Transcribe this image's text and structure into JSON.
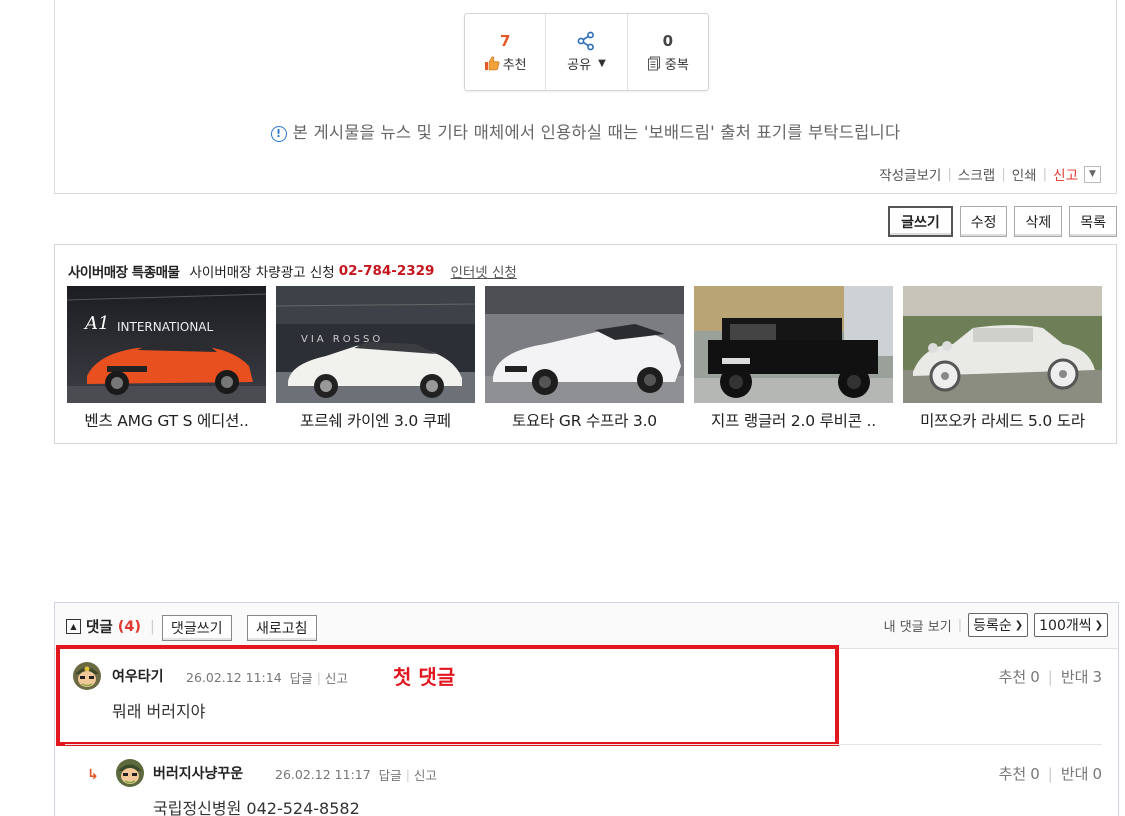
{
  "vote": {
    "recommend_count": "7",
    "recommend_label": "추천",
    "share_label": "공유",
    "duplicate_count": "0",
    "duplicate_label": "중복"
  },
  "notice": "본 게시물을 뉴스 및 기타 매체에서 인용하실 때는 '보배드림' 출처 표기를 부탁드립니다",
  "post_tools": {
    "view_posts": "작성글보기",
    "scrap": "스크랩",
    "print": "인쇄",
    "report": "신고"
  },
  "actions": {
    "write": "글쓰기",
    "edit": "수정",
    "delete": "삭제",
    "list": "목록"
  },
  "cyber": {
    "title": "사이버매장 특종매물",
    "ad_text": "사이버매장 차량광고 신청",
    "phone": "02-784-2329",
    "link": "인터넷 신청",
    "cars": [
      {
        "name": "벤츠 AMG GT S 에디션..",
        "badge": "INTERNATIONAL"
      },
      {
        "name": "포르쉐 카이엔 3.0 쿠페",
        "badge": "VIA ROSSO"
      },
      {
        "name": "토요타 GR 수프라 3.0",
        "badge": ""
      },
      {
        "name": "지프 랭글러 2.0 루비콘 ..",
        "badge": ""
      },
      {
        "name": "미쯔오카 라세드 5.0 도라",
        "badge": ""
      }
    ]
  },
  "comments": {
    "title": "댓글",
    "count": "(4)",
    "write_button": "댓글쓰기",
    "refresh_button": "새로고침",
    "my_comments": "내 댓글 보기",
    "sort_select": "등록순",
    "per_page_select": "100개씩",
    "first_label": "첫 댓글",
    "items": [
      {
        "nick": "여우타기",
        "date": "26.02.12 11:14",
        "reply": "답글",
        "report": "신고",
        "text": "뭐래 버러지야",
        "up_label": "추천",
        "up": "0",
        "down_label": "반대",
        "down": "3"
      },
      {
        "nick": "버러지사냥꾸운",
        "date": "26.02.12 11:17",
        "reply": "답글",
        "report": "신고",
        "text": "국립정신병원 042-524-8582",
        "up_label": "추천",
        "up": "0",
        "down_label": "반대",
        "down": "0"
      }
    ]
  },
  "colors": {
    "accent_red": "#e2161e",
    "recommend_orange": "#e8572a",
    "phone_red": "#c4161c",
    "info_blue": "#2b78d0"
  }
}
